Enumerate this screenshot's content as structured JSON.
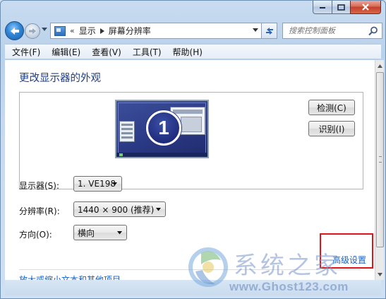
{
  "window": {
    "caption_buttons": [
      "minimize-icon",
      "maximize-icon",
      "close-icon"
    ]
  },
  "nav": {
    "breadcrumb_prefix": "«",
    "breadcrumb": [
      "显示",
      "屏幕分辨率"
    ],
    "search_placeholder": "搜索控制面板"
  },
  "menu": {
    "items": [
      "文件(F)",
      "编辑(E)",
      "查看(V)",
      "工具(T)",
      "帮助(H)"
    ]
  },
  "main": {
    "title": "更改显示器的外观",
    "monitor_number": "1",
    "detect_label": "检测(C)",
    "identify_label": "识别(I)",
    "display_label": "显示器(S):",
    "display_value": "1. VE198",
    "resolution_label": "分辨率(R):",
    "resolution_value": "1440 × 900 (推荐)",
    "orientation_label": "方向(O):",
    "orientation_value": "横向",
    "advanced_link": "高级设置",
    "cut_link": "放大或缩小文本和其他项目"
  },
  "watermark": {
    "title": "系统之家",
    "url": "www.Ghost123.com"
  },
  "colors": {
    "link": "#1561c8",
    "title": "#1e3f8c",
    "highlight_box": "#e0141b",
    "monitor_blue": "#2b3a86"
  }
}
